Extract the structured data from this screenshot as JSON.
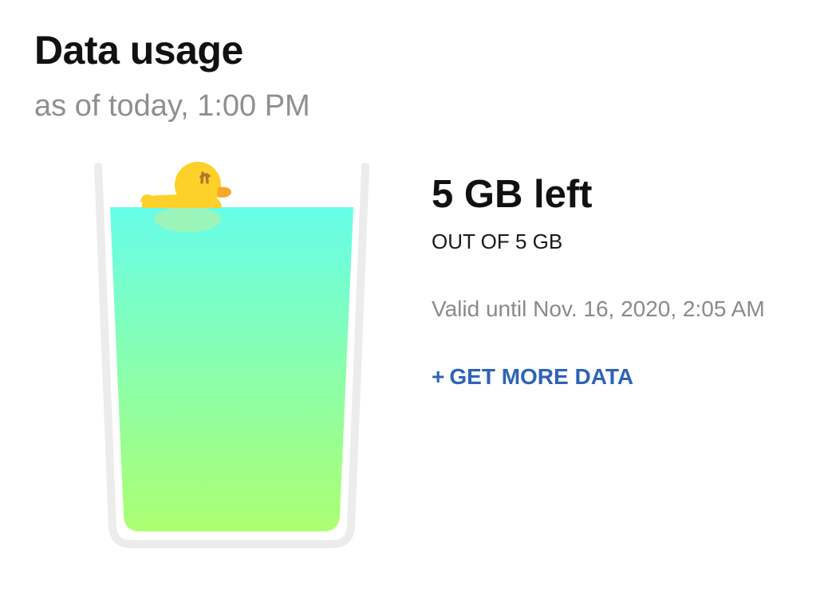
{
  "header": {
    "title": "Data usage",
    "subtitle": "as of today, 1:00 PM"
  },
  "usage": {
    "remaining": "5 GB left",
    "total": "OUT OF 5 GB",
    "remaining_fraction": 1.0,
    "valid_until": "Valid until Nov. 16, 2020, 2:05 AM"
  },
  "actions": {
    "get_more_icon": "+",
    "get_more_label": "GET MORE DATA"
  },
  "colors": {
    "liquid_top": "#66fde9",
    "liquid_bottom": "#adff70",
    "duck": "#fdd12a",
    "link": "#2f63b5"
  },
  "icons": {
    "glass": "glass-of-water-illustration",
    "duck": "rubber-duck-icon",
    "plus": "plus-icon"
  }
}
